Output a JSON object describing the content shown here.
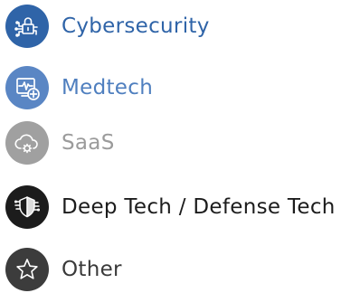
{
  "categories": [
    {
      "label": "Cybersecurity",
      "icon": "lock-circuit-icon",
      "badge_color": "#2f64a8",
      "text_color": "#2f64a8"
    },
    {
      "label": "Medtech",
      "icon": "heartbeat-monitor-plus-icon",
      "badge_color": "#5a86c4",
      "text_color": "#4f7fbf"
    },
    {
      "label": "SaaS",
      "icon": "cloud-gear-icon",
      "badge_color": "#a0a0a0",
      "text_color": "#9b9b9b"
    },
    {
      "label": "Deep Tech / Defense Tech",
      "icon": "shield-circuit-icon",
      "badge_color": "#1c1c1c",
      "text_color": "#1c1c1c"
    },
    {
      "label": "Other",
      "icon": "star-icon",
      "badge_color": "#3c3c3c",
      "text_color": "#3a3a3a"
    }
  ]
}
